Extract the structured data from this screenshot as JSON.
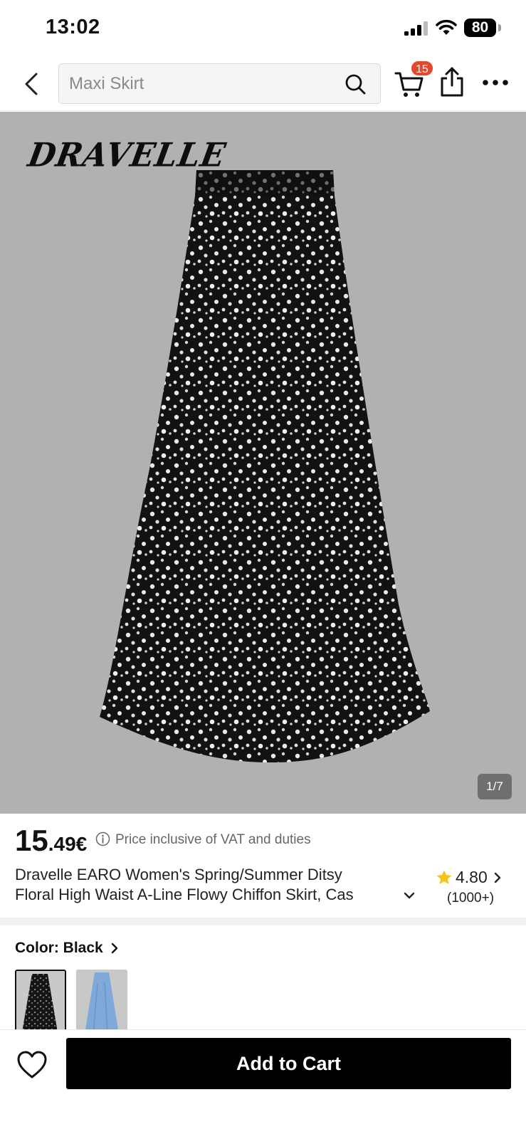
{
  "status_bar": {
    "time": "13:02",
    "battery": "80"
  },
  "nav": {
    "search_placeholder": "Maxi Skirt",
    "cart_count": "15"
  },
  "gallery": {
    "brand_logo": "DRAVELLE",
    "page_indicator": "1/7"
  },
  "product": {
    "price_integer": "15",
    "price_decimal": ".49€",
    "vat_note": "Price inclusive of VAT and duties",
    "title_line1": "Dravelle EARO Women's Spring/Summer Ditsy",
    "title_line2": "Floral High Waist A-Line Flowy Chiffon Skirt, Cas",
    "rating": "4.80",
    "review_count": "(1000+)"
  },
  "color": {
    "label": "Color: Black",
    "options": [
      "black-floral",
      "light-blue"
    ]
  },
  "actions": {
    "add_to_cart": "Add to Cart"
  },
  "colors": {
    "badge": "#e4472b",
    "star": "#f5c518",
    "button": "#000000",
    "image_background": "#b1b1b1"
  },
  "icons": {
    "back": "chevron-left-icon",
    "search": "search-icon",
    "cart": "cart-icon",
    "share": "share-icon",
    "more": "more-icon",
    "wishlist": "heart-icon",
    "rating": "star-icon"
  }
}
